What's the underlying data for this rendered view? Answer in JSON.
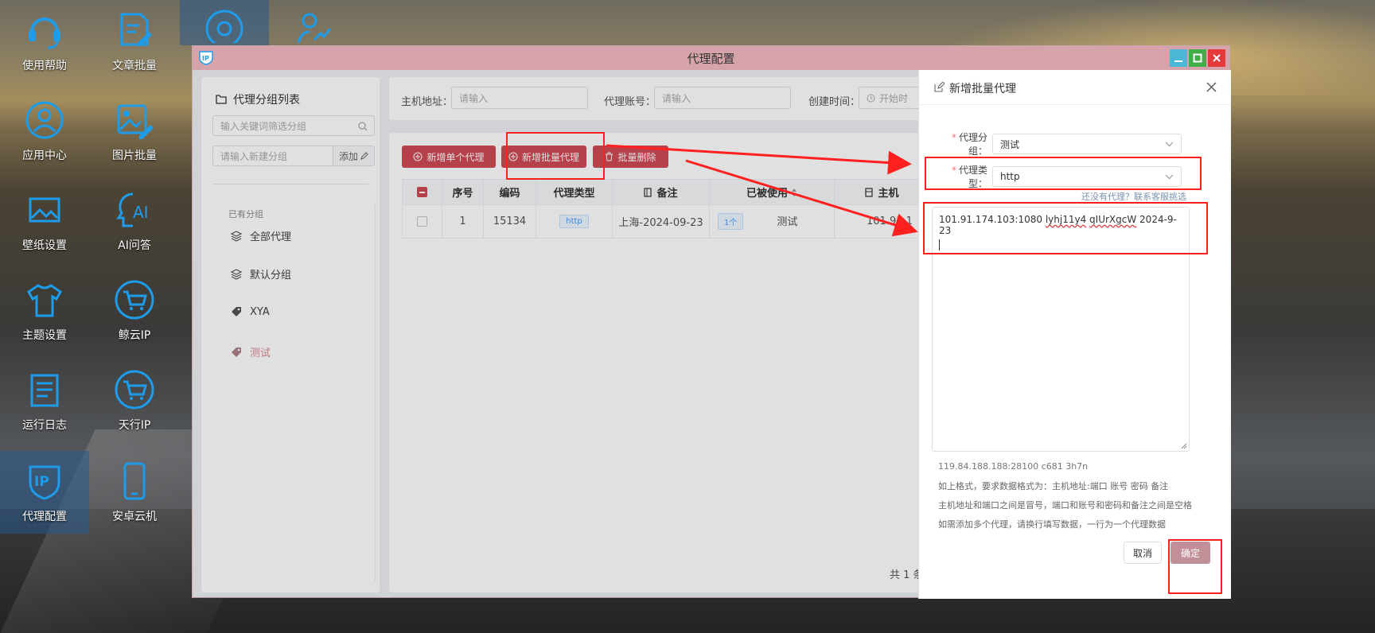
{
  "desktop": {
    "icons": [
      {
        "label": "使用帮助",
        "icon": "headset-icon"
      },
      {
        "label": "文章批量",
        "icon": "edit-document-icon"
      },
      {
        "label": "应用中心",
        "icon": "user-circle-icon"
      },
      {
        "label": "图片批量",
        "icon": "image-edit-icon"
      },
      {
        "label": "壁纸设置",
        "icon": "picture-icon"
      },
      {
        "label": "AI问答",
        "icon": "ai-head-icon"
      },
      {
        "label": "主题设置",
        "icon": "tshirt-icon"
      },
      {
        "label": "鲸云IP",
        "icon": "cart-icon"
      },
      {
        "label": "运行日志",
        "icon": "log-icon"
      },
      {
        "label": "天行IP",
        "icon": "cart-icon"
      },
      {
        "label": "代理配置",
        "icon": "ip-shield-icon"
      },
      {
        "label": "安卓云机",
        "icon": "phone-icon"
      }
    ]
  },
  "window": {
    "title": "代理配置",
    "buttons": {
      "minimize": "minimize-icon",
      "maximize": "maximize-icon",
      "close": "close-icon"
    }
  },
  "sidebar": {
    "title": "代理分组列表",
    "filter_placeholder": "输入关键词筛选分组",
    "new_group_placeholder": "请输入新建分组",
    "add_label": "添加",
    "section_label": "已有分组",
    "groups": [
      {
        "label": "全部代理",
        "icon": "layers-icon"
      },
      {
        "label": "默认分组",
        "icon": "layers-icon"
      },
      {
        "label": "XYA",
        "icon": "tag-icon"
      },
      {
        "label": "测试",
        "icon": "tag-icon"
      }
    ]
  },
  "search": {
    "host_label": "主机地址：",
    "host_placeholder": "请输入",
    "account_label": "代理账号：",
    "account_placeholder": "请输入",
    "created_label": "创建时间：",
    "created_placeholder": "开始时"
  },
  "actions": {
    "add_single": "新增单个代理",
    "add_batch": "新增批量代理",
    "batch_delete": "批量删除"
  },
  "table": {
    "headers": [
      "序号",
      "编码",
      "代理类型",
      "备注",
      "已被使用",
      "主机"
    ],
    "rows": [
      {
        "index": "1",
        "code": "15134",
        "type": "http",
        "remark": "上海-2024-09-23",
        "used_count": "1个",
        "used_group": "测试",
        "host": "101.91.1"
      }
    ],
    "footer": "共 1 条"
  },
  "drawer": {
    "title": "新增批量代理",
    "group_label": "代理分组：",
    "group_value": "测试",
    "type_label": "代理类型：",
    "type_value": "http",
    "help_link": "还没有代理？联系客服挑选",
    "textarea_prefix": "101.91.174.103:1080 ",
    "textarea_account": "lyhj11y4",
    "textarea_password": "qIUrXgcW",
    "textarea_suffix": " 2024-9-23",
    "sample": "119.84.188.188:28100 c681 3h7n",
    "hint1": "如上格式，要求数据格式为：主机地址:端口 账号 密码 备注",
    "hint2": "主机地址和端口之间是冒号，端口和账号和密码和备注之间是空格",
    "hint3": "如需添加多个代理，请换行填写数据，一行为一个代理数据",
    "cancel": "取消",
    "confirm": "确定"
  },
  "colors": {
    "titlebar": "#d7a3aa",
    "action_button": "#d04a55",
    "confirm_button": "#c08f97",
    "annotation": "#ff2020",
    "icon_blue": "#1e9be9"
  }
}
